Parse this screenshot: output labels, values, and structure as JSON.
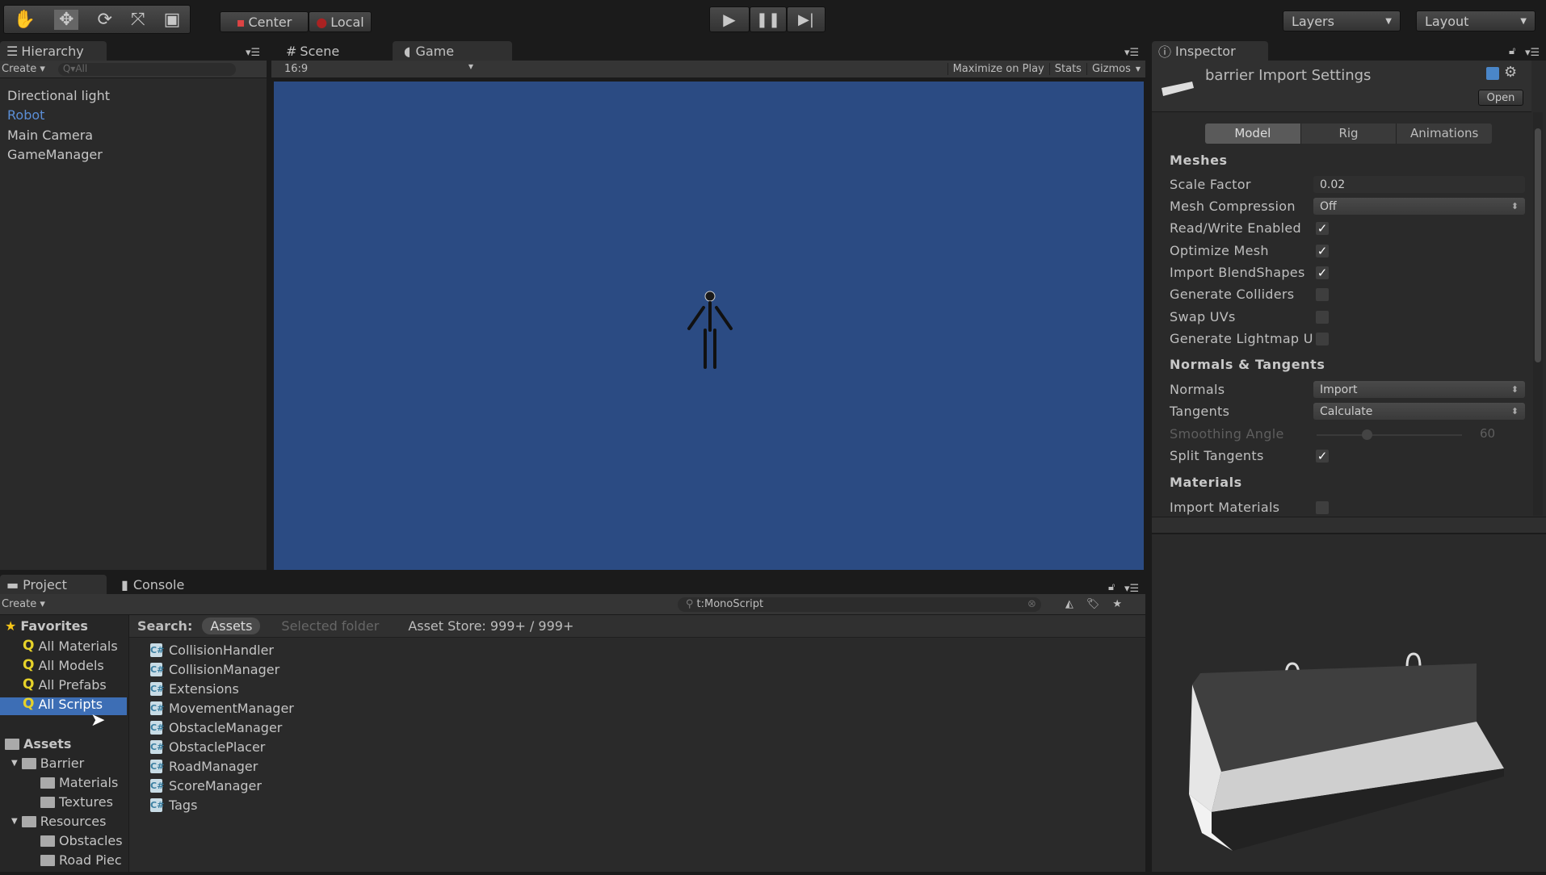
{
  "toolbar": {
    "tools": [
      "hand-icon",
      "move-icon",
      "rotate-icon",
      "scale-icon",
      "rect-icon"
    ],
    "pivot": "Center",
    "space": "Local",
    "layers": "Layers",
    "layout": "Layout"
  },
  "hierarchy": {
    "tab": "Hierarchy",
    "create": "Create ▾",
    "search_placeholder": "Q▾All",
    "items": [
      "Directional light",
      "Robot",
      "Main Camera",
      "GameManager"
    ],
    "selected_color": "#5b8ed6"
  },
  "game": {
    "tabs": [
      "Scene",
      "Game"
    ],
    "aspect": "16:9",
    "maximize": "Maximize on Play",
    "stats": "Stats",
    "gizmos": "Gizmos",
    "background": "#2b4b83"
  },
  "inspector": {
    "tab": "Inspector",
    "title": "barrier Import Settings",
    "open": "Open",
    "tabs": [
      "Model",
      "Rig",
      "Animations"
    ],
    "meshes": {
      "header": "Meshes",
      "scale_factor_label": "Scale Factor",
      "scale_factor": "0.02",
      "mesh_compression_label": "Mesh Compression",
      "mesh_compression": "Off",
      "checks": [
        {
          "label": "Read/Write Enabled",
          "checked": true
        },
        {
          "label": "Optimize Mesh",
          "checked": true
        },
        {
          "label": "Import BlendShapes",
          "checked": true
        },
        {
          "label": "Generate Colliders",
          "checked": false
        },
        {
          "label": "Swap UVs",
          "checked": false
        },
        {
          "label": "Generate Lightmap U",
          "checked": false
        }
      ]
    },
    "normals": {
      "header": "Normals & Tangents",
      "normals_label": "Normals",
      "normals": "Import",
      "tangents_label": "Tangents",
      "tangents": "Calculate",
      "smoothing_label": "Smoothing Angle",
      "smoothing": "60",
      "split_label": "Split Tangents",
      "split": true
    },
    "materials": {
      "header": "Materials",
      "import_label": "Import Materials",
      "import": false
    }
  },
  "project": {
    "tabs": [
      "Project",
      "Console"
    ],
    "create": "Create ▾",
    "search": "t:MonoScript",
    "search_label": "Search:",
    "scope_assets": "Assets",
    "scope_folder": "Selected folder",
    "asset_store": "Asset Store: 999+ / 999+",
    "favorites": {
      "label": "Favorites",
      "items": [
        "All Materials",
        "All Models",
        "All Prefabs",
        "All Scripts"
      ]
    },
    "assets": {
      "label": "Assets",
      "items": [
        "Barrier",
        "Materials",
        "Textures",
        "Resources",
        "Obstacles",
        "Road Piec"
      ]
    },
    "files": [
      "CollisionHandler",
      "CollisionManager",
      "Extensions",
      "MovementManager",
      "ObstacleManager",
      "ObstaclePlacer",
      "RoadManager",
      "ScoreManager",
      "Tags"
    ]
  }
}
